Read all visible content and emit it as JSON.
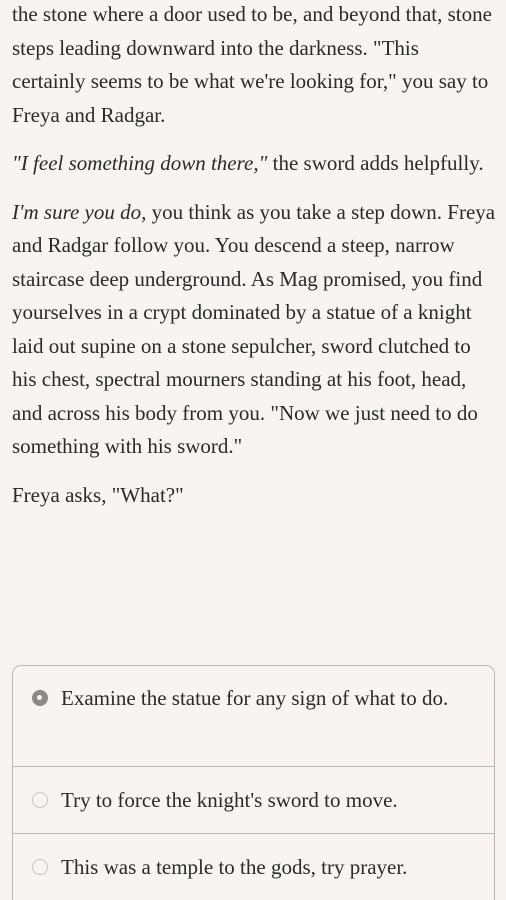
{
  "story": {
    "paragraphs": [
      {
        "parts": [
          {
            "text": "the stone where a door used to be, and beyond that, stone steps leading downward into the darkness. \"This certainly seems to be what we're looking for,\" you say to Freya and Radgar.",
            "italic": false
          }
        ]
      },
      {
        "parts": [
          {
            "text": "\"I feel something down there,\"",
            "italic": true
          },
          {
            "text": " the sword adds helpfully.",
            "italic": false
          }
        ]
      },
      {
        "parts": [
          {
            "text": "I'm sure you do,",
            "italic": true
          },
          {
            "text": " you think as you take a step down. Freya and Radgar follow you. You descend a steep, narrow staircase deep underground. As Mag promised, you find yourselves in a crypt dominated by a statue of a knight laid out supine on a stone sepulcher, sword clutched to his chest, spectral mourners standing at his foot, head, and across his body from you. \"Now we just need to do something with his sword.\"",
            "italic": false
          }
        ]
      },
      {
        "parts": [
          {
            "text": "Freya asks, \"What?\"",
            "italic": false
          }
        ]
      }
    ]
  },
  "choices": [
    {
      "label": "Examine the statue for any sign of what to do.",
      "selected": true
    },
    {
      "label": "Try to force the knight's sword to move.",
      "selected": false
    },
    {
      "label": "This was a temple to the gods, try prayer.",
      "selected": false
    }
  ],
  "colors": {
    "background": "#f7f4f1",
    "text": "#2b2a2a",
    "border": "#bdb8b4",
    "radio_selected": "#8c8986"
  }
}
